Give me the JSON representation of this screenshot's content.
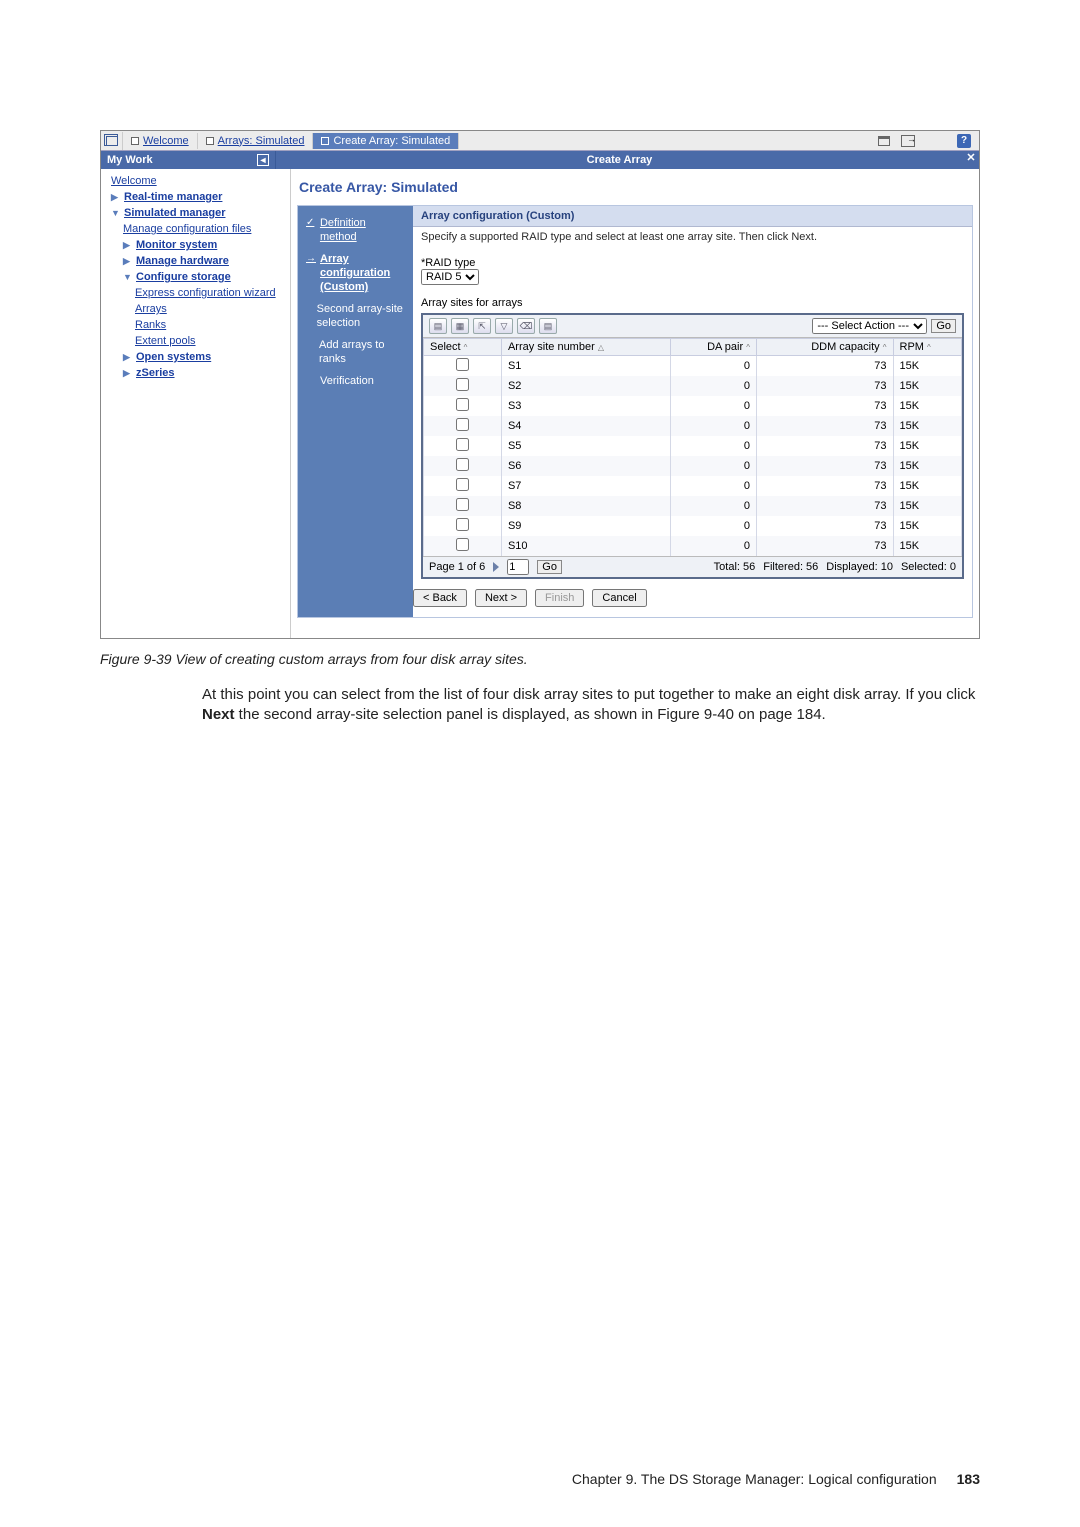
{
  "topTabs": {
    "welcome": "Welcome",
    "arrays": "Arrays: Simulated",
    "create": "Create Array: Simulated"
  },
  "ribbon": {
    "mywork": "My Work",
    "center": "Create Array"
  },
  "sidebar": {
    "welcome": "Welcome",
    "realtime": "Real-time manager",
    "simulated": "Simulated manager",
    "manageConfig": "Manage configuration files",
    "monitor": "Monitor system",
    "manageHw": "Manage hardware",
    "configStorage": "Configure storage",
    "express": "Express configuration wizard",
    "arrays": "Arrays",
    "ranks": "Ranks",
    "extent": "Extent pools",
    "openSys": "Open systems",
    "zseries": "zSeries"
  },
  "main": {
    "title": "Create Array: Simulated"
  },
  "steps": {
    "s1": "Definition method",
    "s2": "Array configuration (Custom)",
    "s3": "Second array-site selection",
    "s4": "Add arrays to ranks",
    "s5": "Verification"
  },
  "wizHead": "Array configuration (Custom)",
  "wizDesc": "Specify a supported RAID type and select at least one array site. Then click Next.",
  "raidLabel": "*RAID type",
  "raidValue": "RAID 5",
  "arraySitesLabel": "Array sites for arrays",
  "selectAction": "--- Select Action ---",
  "goBtn": "Go",
  "cols": {
    "select": "Select",
    "siteNum": "Array site number",
    "daPair": "DA pair",
    "ddm": "DDM capacity",
    "rpm": "RPM"
  },
  "rows": [
    {
      "site": "S1",
      "da": "0",
      "ddm": "73",
      "rpm": "15K"
    },
    {
      "site": "S2",
      "da": "0",
      "ddm": "73",
      "rpm": "15K"
    },
    {
      "site": "S3",
      "da": "0",
      "ddm": "73",
      "rpm": "15K"
    },
    {
      "site": "S4",
      "da": "0",
      "ddm": "73",
      "rpm": "15K"
    },
    {
      "site": "S5",
      "da": "0",
      "ddm": "73",
      "rpm": "15K"
    },
    {
      "site": "S6",
      "da": "0",
      "ddm": "73",
      "rpm": "15K"
    },
    {
      "site": "S7",
      "da": "0",
      "ddm": "73",
      "rpm": "15K"
    },
    {
      "site": "S8",
      "da": "0",
      "ddm": "73",
      "rpm": "15K"
    },
    {
      "site": "S9",
      "da": "0",
      "ddm": "73",
      "rpm": "15K"
    },
    {
      "site": "S10",
      "da": "0",
      "ddm": "73",
      "rpm": "15K"
    }
  ],
  "footer": {
    "page": "Page 1 of 6",
    "pageInput": "1",
    "total": "Total: 56",
    "filtered": "Filtered: 56",
    "displayed": "Displayed: 10",
    "selected": "Selected: 0"
  },
  "btns": {
    "back": "< Back",
    "next": "Next >",
    "finish": "Finish",
    "cancel": "Cancel"
  },
  "caption": "Figure 9-39   View of creating custom arrays from four disk array sites.",
  "body": {
    "p1a": "At this point you can select from the list of four disk array sites to put together to make an eight disk array. If you click ",
    "p1b": "Next",
    "p1c": " the second array-site selection panel is displayed, as shown in Figure 9-40 on page 184."
  },
  "pageFooter": {
    "chapter": "Chapter 9. The DS Storage Manager: Logical configuration",
    "num": "183"
  }
}
